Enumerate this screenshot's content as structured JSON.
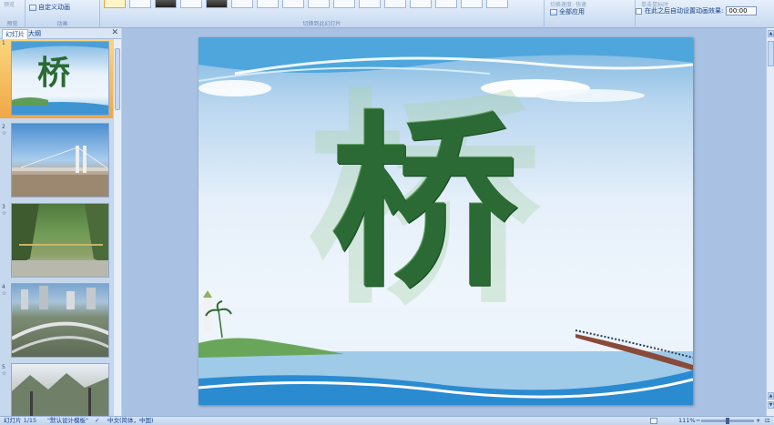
{
  "ribbon": {
    "preview_group_label": "预览",
    "preview_button": "预览",
    "custom_animation_button": "自定义动画",
    "animation_group_label": "动画",
    "transition_group_label": "切换到此幻灯片",
    "speed_label": "切换速度:",
    "speed_value": "快速",
    "apply_all_button": "全部应用",
    "advance_label": "单击鼠标时",
    "auto_advance_label": "在此之后自动设置动画效果:",
    "auto_advance_time": "00:00"
  },
  "panel": {
    "tab_slides": "幻灯片",
    "tab_outline": "大纲",
    "close_glyph": "✕",
    "slides": [
      {
        "number": "1",
        "title_char": "桥",
        "kind": "title"
      },
      {
        "number": "2",
        "kind": "bridge-photo"
      },
      {
        "number": "3",
        "kind": "suspension-photo"
      },
      {
        "number": "4",
        "kind": "highway-photo"
      },
      {
        "number": "5",
        "kind": "valley-photo"
      }
    ],
    "star_glyph": "☆"
  },
  "slide": {
    "main_char": "桥"
  },
  "status": {
    "slide_info": "幻灯片 1/15",
    "theme": "\"默认设计模板\"",
    "language": "中文(简体，中国)",
    "zoom": "111%",
    "minus": "−",
    "plus": "+"
  },
  "colors": {
    "accent": "#15428b",
    "selected_thumb": "#f0a646",
    "char_green": "#2b6a34"
  }
}
